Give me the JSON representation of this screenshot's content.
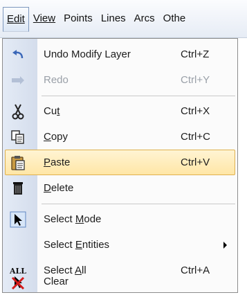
{
  "menubar": {
    "items": [
      "Edit",
      "View",
      "Points",
      "Lines",
      "Arcs",
      "Othe"
    ]
  },
  "menu": {
    "undo": {
      "label": "Undo Modify Layer",
      "shortcut": "Ctrl+Z",
      "icon": "undo-icon"
    },
    "redo": {
      "label": "Redo",
      "shortcut": "Ctrl+Y",
      "icon": "redo-icon"
    },
    "cut": {
      "label_pre": "Cu",
      "label_ul": "t",
      "shortcut": "Ctrl+X",
      "icon": "scissors-icon"
    },
    "copy": {
      "label_ul": "C",
      "label_post": "opy",
      "shortcut": "Ctrl+C",
      "icon": "copy-icon"
    },
    "paste": {
      "label_ul": "P",
      "label_post": "aste",
      "shortcut": "Ctrl+V",
      "icon": "clipboard-icon"
    },
    "delete": {
      "label_ul": "D",
      "label_post": "elete",
      "icon": "trash-icon"
    },
    "select_mode": {
      "label_pre": "Select ",
      "label_ul": "M",
      "label_post": "ode",
      "icon": "cursor-arrow-icon"
    },
    "select_entities": {
      "label_pre": "Select ",
      "label_ul": "E",
      "label_post": "ntities",
      "icon": "submenu-arrow-icon"
    },
    "select_all": {
      "label_pre": "Select ",
      "label_ul": "A",
      "label_post": "ll",
      "shortcut": "Ctrl+A",
      "icon_text": "ALL"
    },
    "clear": {
      "label": "Clear",
      "icon": "clear-selection-icon"
    }
  },
  "colors": {
    "highlight": "#ffe6a6",
    "highlight_border": "#e0b04c",
    "strip": "#dbe3f0",
    "disabled_text": "#9aa0a8"
  }
}
